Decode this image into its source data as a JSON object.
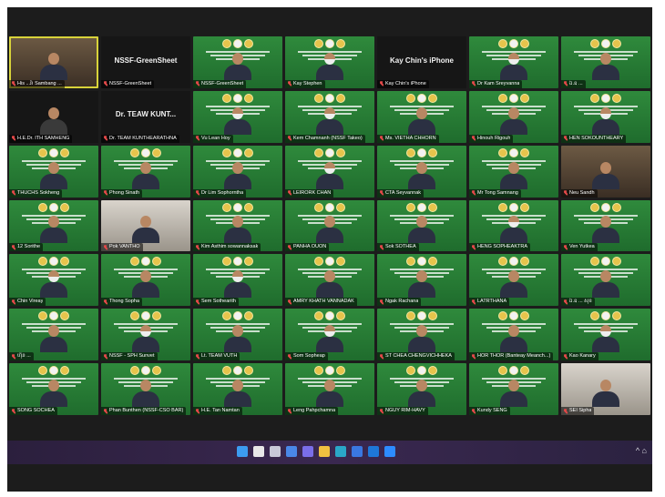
{
  "meeting": {
    "participants": [
      {
        "name": "His ...រ៉ា Sambang ...",
        "style": "cam",
        "selected": true
      },
      {
        "name": "NSSF-GreenSheet",
        "style": "dark",
        "center": "NSSF-GreenSheet"
      },
      {
        "name": "NSSF-GreenSheet",
        "style": "green"
      },
      {
        "name": "Kay Stephen",
        "style": "green",
        "mask": true
      },
      {
        "name": "Kay Chin's iPhone",
        "style": "dark",
        "center": "Kay Chin's iPhone"
      },
      {
        "name": "Dr Kam Sreyvanna",
        "style": "green",
        "mask": true
      },
      {
        "name": "ឯ.ឧ ...",
        "style": "green"
      },
      {
        "name": "H.E.Dr. ITH SAMHENG",
        "style": "dark"
      },
      {
        "name": "Dr. TEAM KUNTHEARATHNA",
        "style": "dark",
        "center": "Dr. TEAW KUNT..."
      },
      {
        "name": "Vu Lean Hoy",
        "style": "green",
        "mask": true
      },
      {
        "name": "Kem Chamnanh (NSSF Takeo)",
        "style": "green",
        "mask": true
      },
      {
        "name": "Ms. VIETHA CHHORN",
        "style": "green"
      },
      {
        "name": "Hinouh Rigouh",
        "style": "green"
      },
      {
        "name": "HEN SOKOUNTHEARY",
        "style": "green",
        "mask": true
      },
      {
        "name": "THUCHS Sokheng",
        "style": "green"
      },
      {
        "name": "Phong Sinath",
        "style": "green"
      },
      {
        "name": "Dr Lim Sophorntha",
        "style": "green"
      },
      {
        "name": "LEIRORK CHAN",
        "style": "green",
        "mask": true
      },
      {
        "name": "CTA Seyvannak",
        "style": "green"
      },
      {
        "name": "Mr Tong Samnang",
        "style": "green"
      },
      {
        "name": "Neu Sandh",
        "style": "cam"
      },
      {
        "name": "12 Sorithe",
        "style": "green"
      },
      {
        "name": "Pok VANTHO",
        "style": "room"
      },
      {
        "name": "Kim Asthim sowannaksak",
        "style": "green"
      },
      {
        "name": "PANHA OUON",
        "style": "green"
      },
      {
        "name": "Sok SOTHEA",
        "style": "green"
      },
      {
        "name": "HENG SOPHEAKTRA",
        "style": "green",
        "mask": true
      },
      {
        "name": "Ven Yutkea",
        "style": "green"
      },
      {
        "name": "Chin Vireay",
        "style": "green",
        "mask": true
      },
      {
        "name": "Thong Sopha",
        "style": "green"
      },
      {
        "name": "Sem Sothearith",
        "style": "green",
        "mask": true
      },
      {
        "name": "AMRY KHATH VANNADAK",
        "style": "green"
      },
      {
        "name": "Ngak Rachana",
        "style": "green"
      },
      {
        "name": "LATRTHANA",
        "style": "green"
      },
      {
        "name": "ឯ.ឧ ... សុខ",
        "style": "green"
      },
      {
        "name": "ហ៊ុន ...",
        "style": "green"
      },
      {
        "name": "NSSF - SPH Sunvet",
        "style": "green",
        "mask": true
      },
      {
        "name": "Lt. TEAM VUTH",
        "style": "green"
      },
      {
        "name": "Som Sopheap",
        "style": "green",
        "mask": true
      },
      {
        "name": "ST CHEA CHENGVICHHEKA",
        "style": "green"
      },
      {
        "name": "HOR THOR (Banteay Meanch...)",
        "style": "green"
      },
      {
        "name": "Kao Kanary",
        "style": "green",
        "mask": true
      },
      {
        "name": "SONG SOCHEA",
        "style": "green"
      },
      {
        "name": "Phan Bunthen (NSSF-CSO BAR)",
        "style": "green"
      },
      {
        "name": "H.E. Tan Namtan",
        "style": "green"
      },
      {
        "name": "Leng Pahpchamna",
        "style": "green"
      },
      {
        "name": "NGUY RIM-HAVY",
        "style": "green"
      },
      {
        "name": "Kundy SENG",
        "style": "green"
      },
      {
        "name": "SEI Sipha",
        "style": "room"
      }
    ]
  },
  "taskbar": {
    "icons": [
      {
        "name": "windows-start-icon",
        "color": "#3c9cf0"
      },
      {
        "name": "search-icon",
        "color": "#e8e8e8"
      },
      {
        "name": "task-view-icon",
        "color": "#c8c8d8"
      },
      {
        "name": "widgets-icon",
        "color": "#4a88e8"
      },
      {
        "name": "teams-chat-icon",
        "color": "#7a6ee8"
      },
      {
        "name": "file-explorer-icon",
        "color": "#f0c040"
      },
      {
        "name": "edge-browser-icon",
        "color": "#2aa7c8"
      },
      {
        "name": "store-icon",
        "color": "#3a78e0"
      },
      {
        "name": "outlook-icon",
        "color": "#1e78d8"
      },
      {
        "name": "zoom-icon",
        "color": "#2d8cff"
      }
    ],
    "tray": "^  ⌂"
  }
}
